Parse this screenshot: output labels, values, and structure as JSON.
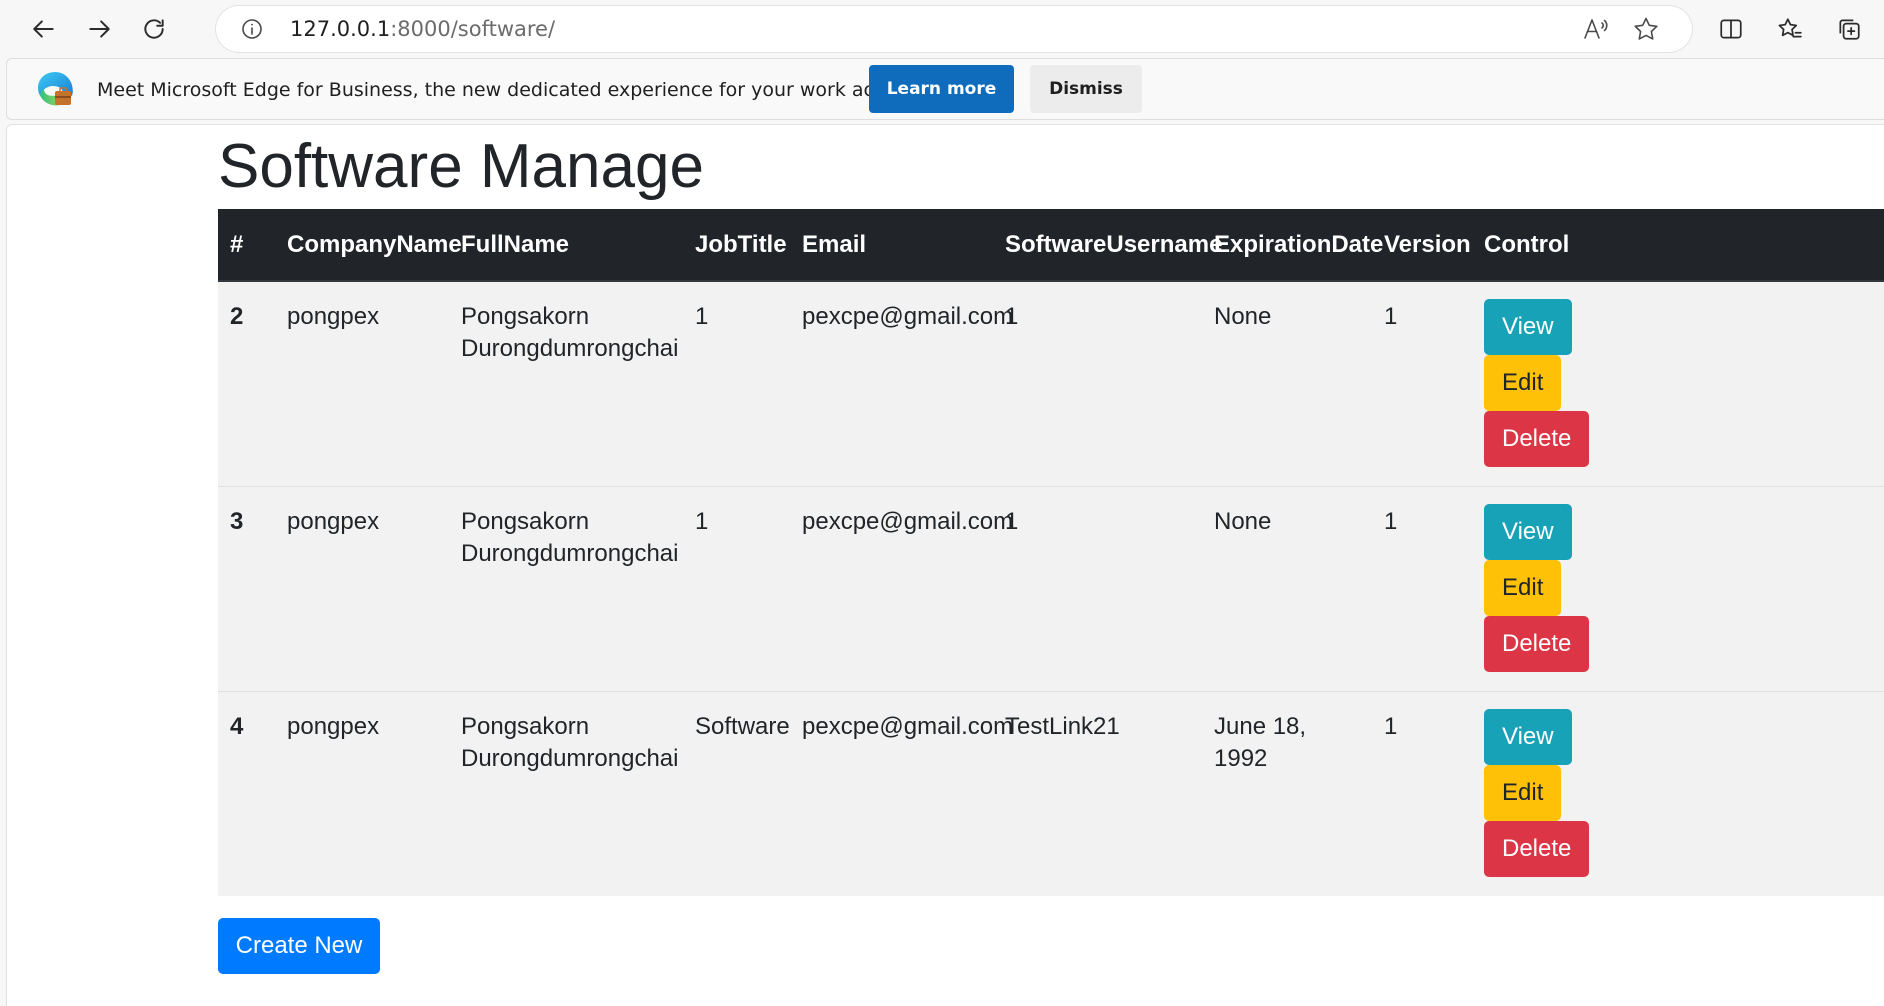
{
  "browser": {
    "url_host": "127.0.0.1",
    "url_rest": ":8000/software/",
    "icons": {
      "back": "back-arrow-icon",
      "forward": "forward-arrow-icon",
      "reload": "reload-icon",
      "site_info": "info-icon",
      "read_aloud": "read-aloud-icon",
      "favorite": "star-icon",
      "split_screen": "split-screen-icon",
      "favorites": "favorites-icon",
      "collections": "collections-icon"
    }
  },
  "infobar": {
    "message": "Meet Microsoft Edge for Business, the new dedicated experience for your work account.",
    "learn_more_label": "Learn more",
    "dismiss_label": "Dismiss",
    "learn_more_color": "#0f6cbd"
  },
  "page": {
    "title": "Software Manage",
    "table": {
      "columns": [
        "#",
        "CompanyName",
        "FullName",
        "JobTitle",
        "Email",
        "SoftwareUsername",
        "ExpirationDate",
        "Version",
        "Control"
      ],
      "rows": [
        {
          "id": "2",
          "company": "pongpex",
          "full_name": "Pongsakorn Durongdumrongchai",
          "job_title": "1",
          "email": "pexcpe@gmail.com",
          "software_username": "1",
          "expiration_date": "None",
          "version": "1"
        },
        {
          "id": "3",
          "company": "pongpex",
          "full_name": "Pongsakorn Durongdumrongchai",
          "job_title": "1",
          "email": "pexcpe@gmail.com",
          "software_username": "1",
          "expiration_date": "None",
          "version": "1"
        },
        {
          "id": "4",
          "company": "pongpex",
          "full_name": "Pongsakorn Durongdumrongchai",
          "job_title": "Software",
          "email": "pexcpe@gmail.com",
          "software_username": "TestLink21",
          "expiration_date": "June 18, 1992",
          "version": "1"
        }
      ],
      "actions": {
        "view": "View",
        "edit": "Edit",
        "delete": "Delete"
      }
    },
    "create_new_label": "Create New",
    "colors": {
      "view": "#17a2b8",
      "edit": "#ffc107",
      "delete": "#dc3545",
      "primary": "#007bff",
      "header": "#212529"
    }
  }
}
